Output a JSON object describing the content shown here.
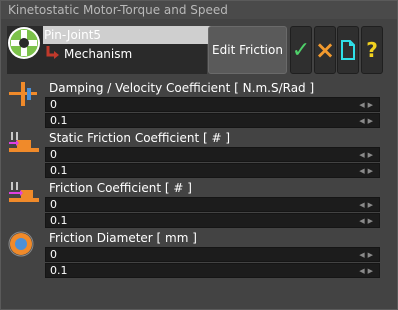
{
  "window": {
    "title": "Kinetostatic Motor-Torque and Speed"
  },
  "tree": {
    "joint": "Pin-Joint5",
    "child": "Mechanism"
  },
  "toolbar": {
    "edit_label": "Edit Friction",
    "ok_glyph": "✓",
    "cancel_glyph": "×",
    "help_glyph": "?"
  },
  "rows": [
    {
      "label": "Damping / Velocity Coefficient [ N.m.S/Rad ]",
      "value": "0",
      "increment": "0.1",
      "icon": "damping-icon"
    },
    {
      "label": "Static Friction Coefficient [ # ]",
      "value": "0",
      "increment": "0.1",
      "icon": "static-friction-icon"
    },
    {
      "label": "Friction Coefficient [ # ]",
      "value": "0",
      "increment": "0.1",
      "icon": "friction-icon"
    },
    {
      "label": "Friction Diameter [ mm ]",
      "value": "0",
      "increment": "0.1",
      "icon": "friction-diameter-icon"
    }
  ],
  "colors": {
    "ok": "#4fd16a",
    "cancel": "#f29a2e",
    "new": "#2fe0e8",
    "help": "#f2d21f",
    "icon_orange": "#f08a2a",
    "icon_magenta": "#e040e0"
  }
}
